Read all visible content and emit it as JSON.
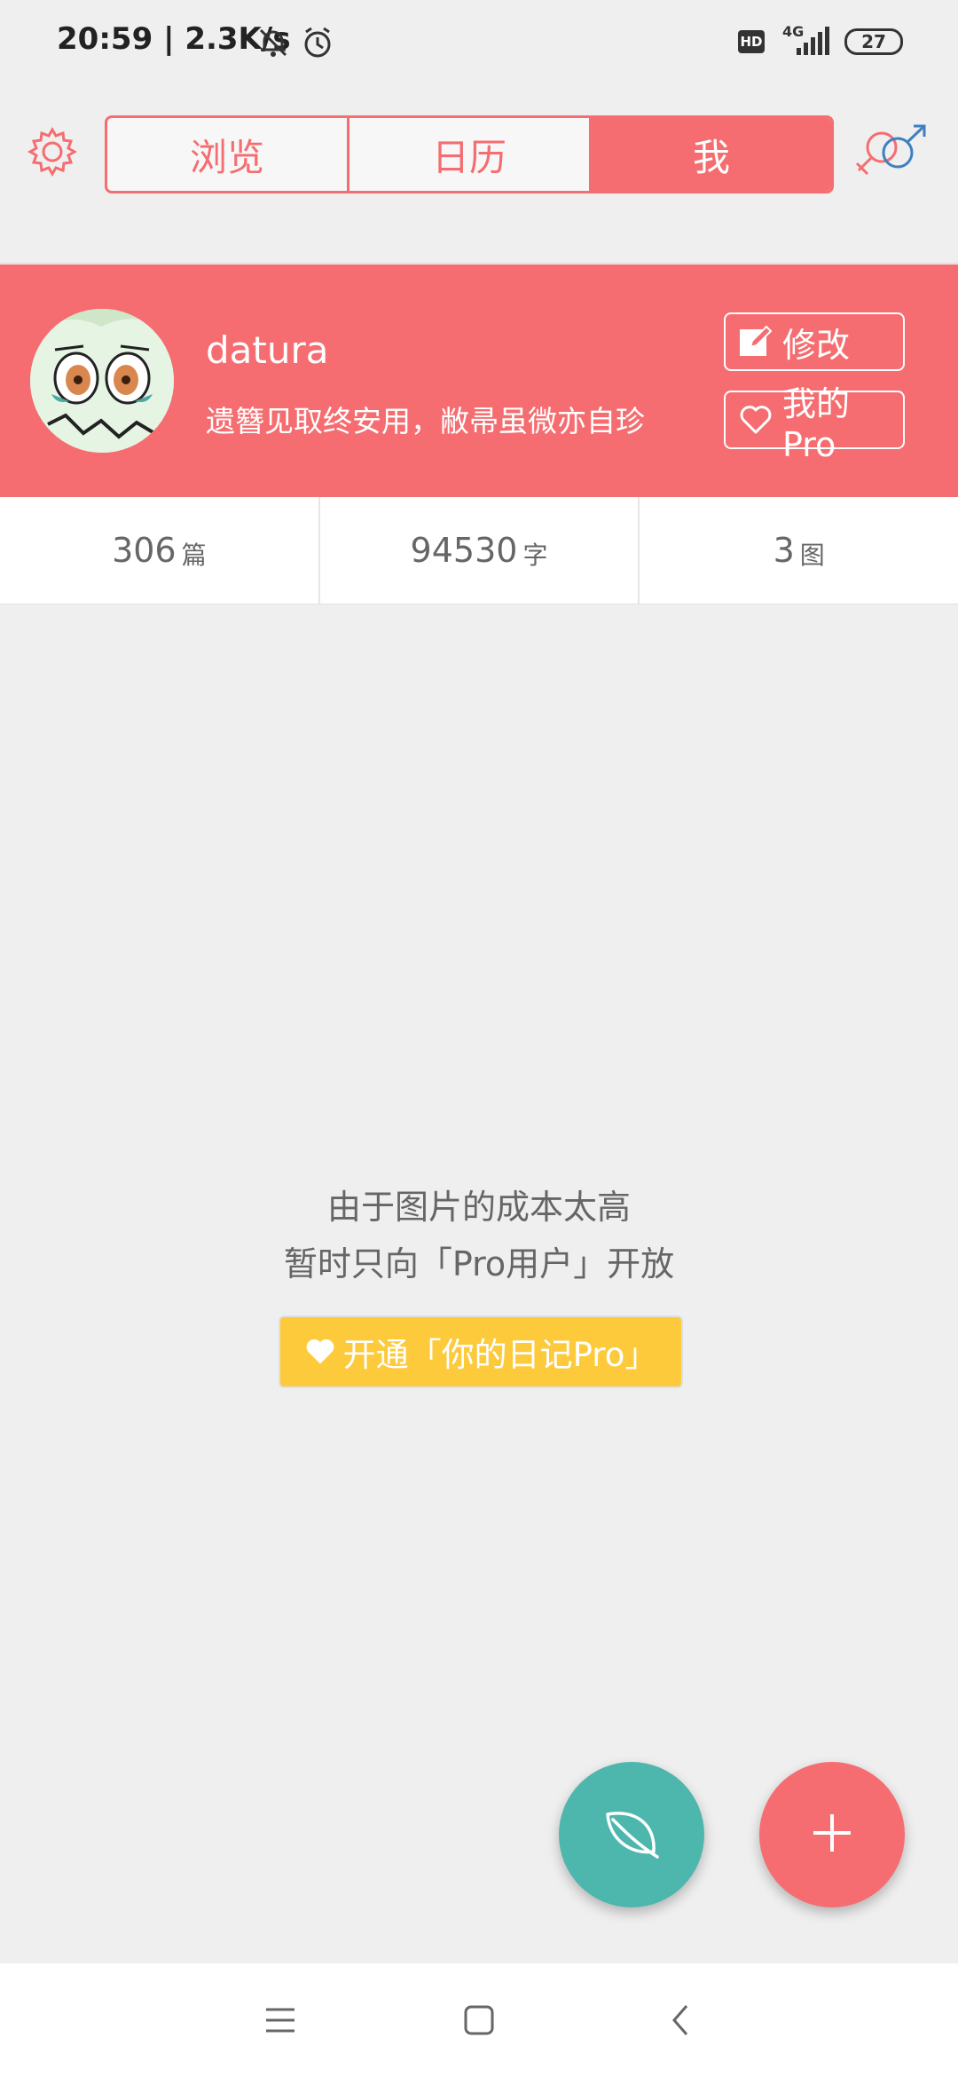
{
  "status_bar": {
    "time_speed": "20:59 | 2.3K/s",
    "network": "4G",
    "battery": "27"
  },
  "tabs": [
    {
      "label": "浏览",
      "active": false
    },
    {
      "label": "日历",
      "active": false
    },
    {
      "label": "我",
      "active": true
    }
  ],
  "profile": {
    "username": "datura",
    "bio": "遗簪见取终安用，敝帚虽微亦自珍",
    "edit_label": "修改",
    "pro_label": "我的Pro"
  },
  "stats": [
    {
      "value": "306",
      "unit": "篇"
    },
    {
      "value": "94530",
      "unit": "字"
    },
    {
      "value": "3",
      "unit": "图"
    }
  ],
  "empty_state": {
    "line1": "由于图片的成本太高",
    "line2": "暂时只向「Pro用户」开放",
    "button_label": "开通「你的日记Pro」"
  },
  "colors": {
    "accent": "#f56d70",
    "teal": "#4db7ad",
    "pro_yellow": "#fdca3b",
    "background": "#efefef"
  },
  "icons": {
    "settings": "gear-icon",
    "gender": "gender-icon",
    "edit": "edit-icon",
    "pro": "heart-icon",
    "leaf": "leaf-icon",
    "add": "plus-icon"
  }
}
